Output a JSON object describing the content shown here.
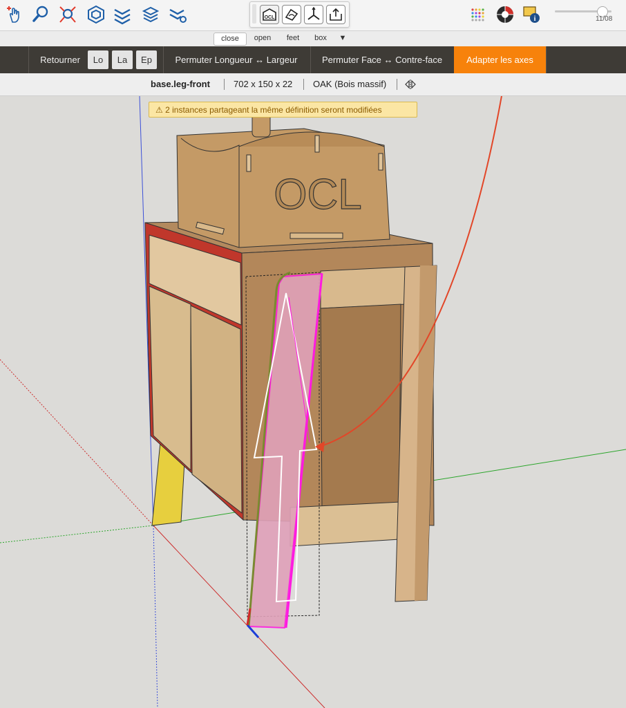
{
  "toolbar": {
    "icons": [
      "select-hand-icon",
      "zoom-icon",
      "zoom-extents-icon",
      "component-icon",
      "layers-icon",
      "stack-icon",
      "settings-layers-icon"
    ],
    "date": "11/08",
    "slider_fraction": 0.83
  },
  "ocl_toolbar": {
    "buttons": [
      "ocl-logo-icon",
      "material-icon",
      "axes-icon",
      "export-icon"
    ],
    "logo_text": "OCL"
  },
  "tabs": {
    "items": [
      "close",
      "open",
      "feet",
      "box",
      "▼"
    ]
  },
  "nav": {
    "back": "Retourner",
    "chip_lo": "Lo",
    "chip_la": "La",
    "chip_ep": "Ep",
    "swap_lw": "Permuter Longueur ↔ Largeur",
    "swap_face": "Permuter Face ↔ Contre-face",
    "fit_axes": "Adapter les axes",
    "accent": "#f7820b"
  },
  "info": {
    "name": "base.leg-front",
    "size": "702 x 150 x 22",
    "material": "OAK (Bois massif)"
  },
  "warning": {
    "text": "⚠ 2 instances partageant la même définition seront modifiées"
  },
  "model": {
    "box_label": "OCL"
  }
}
